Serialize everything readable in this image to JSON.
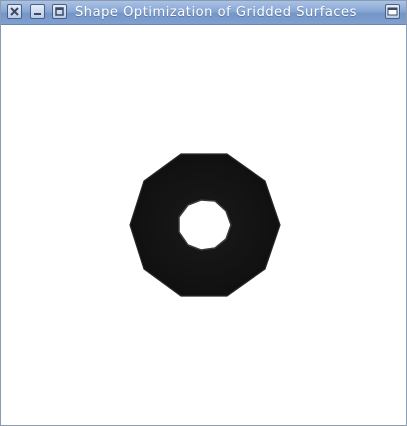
{
  "window": {
    "title": "Shape Optimization of Gridded Surfaces"
  },
  "titlebar_buttons": {
    "close_icon": "close-icon",
    "minimize_icon": "minimize-icon",
    "maximize_icon": "maximize-icon",
    "menu_icon": "window-menu-icon"
  },
  "scene": {
    "shape": "decagonal ring",
    "ring_color": "#141414",
    "hole_color": "#ffffff",
    "background_color": "#ffffff"
  }
}
